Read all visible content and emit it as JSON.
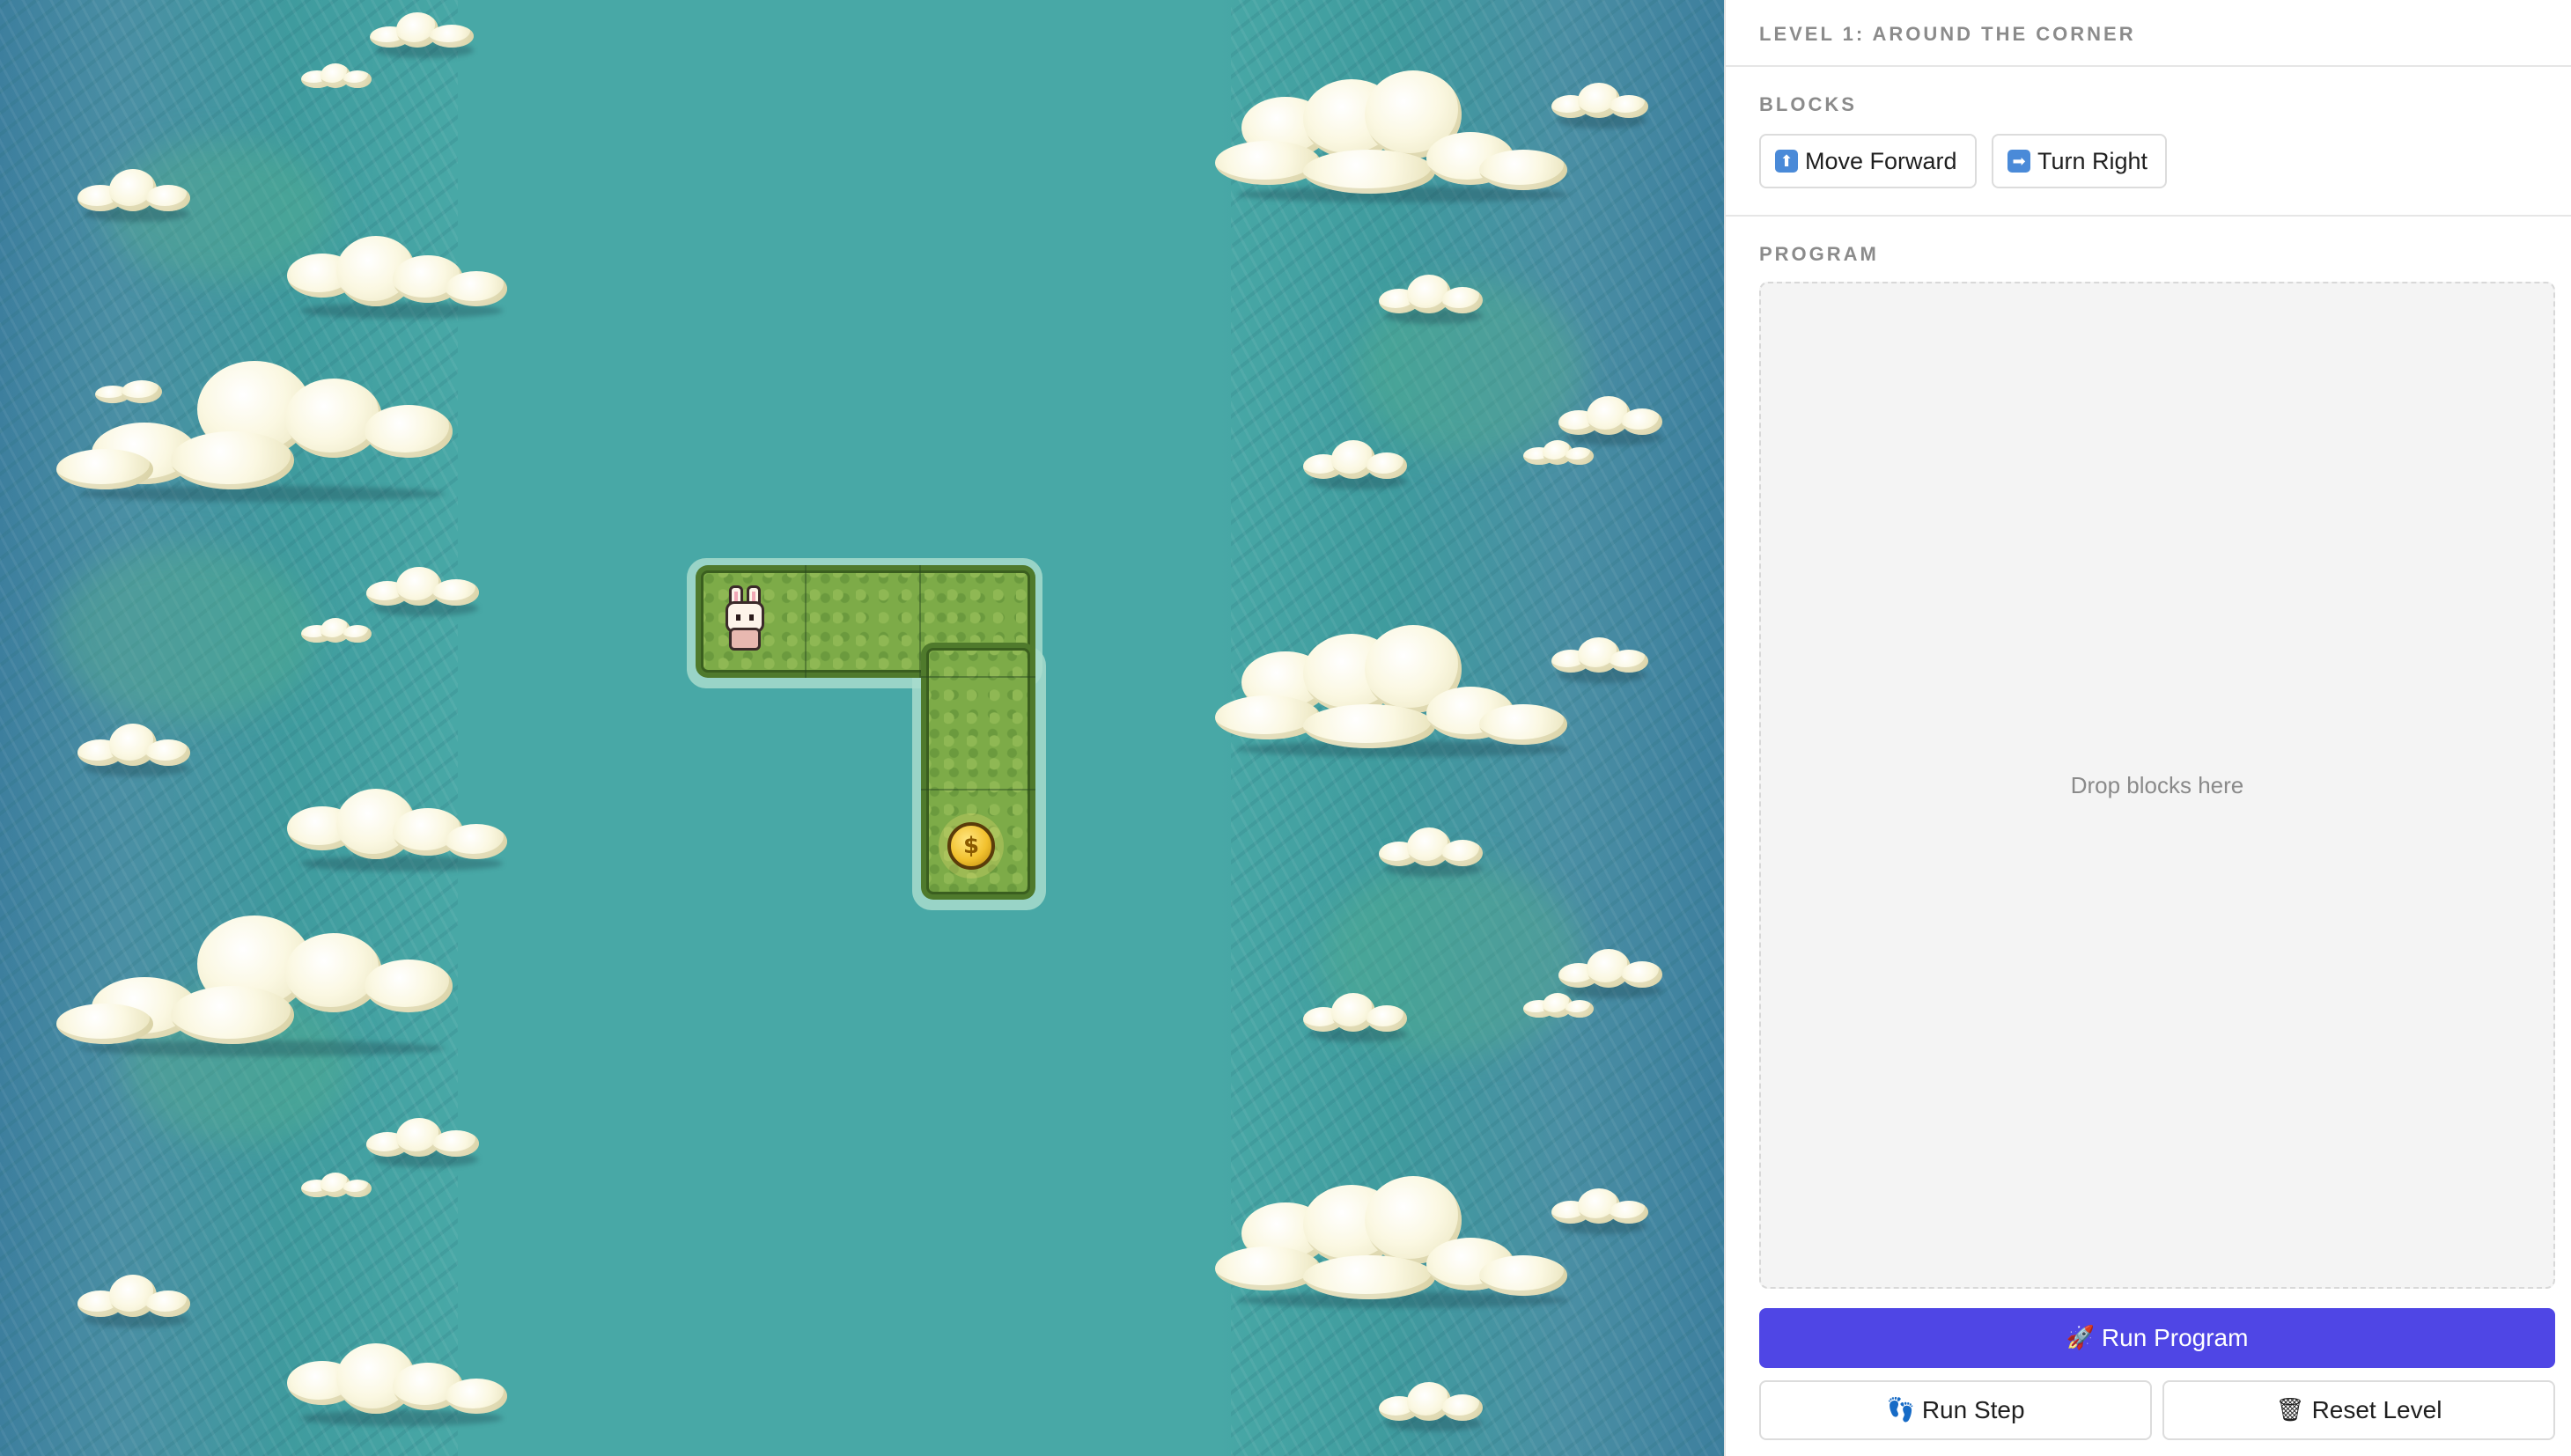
{
  "level": {
    "title": "LEVEL 1: AROUND THE CORNER"
  },
  "blocks": {
    "section_label": "BLOCKS",
    "items": [
      {
        "label": "Move Forward",
        "icon": "up-arrow-icon",
        "glyph": "⬆"
      },
      {
        "label": "Turn Right",
        "icon": "right-arrow-icon",
        "glyph": "➡"
      }
    ]
  },
  "program": {
    "section_label": "PROGRAM",
    "placeholder": "Drop blocks here"
  },
  "controls": {
    "run_program": {
      "label": "Run Program",
      "icon": "rocket-icon",
      "glyph": "🚀"
    },
    "run_step": {
      "label": "Run Step",
      "icon": "footprints-icon",
      "glyph": "👣"
    },
    "reset_level": {
      "label": "Reset Level",
      "icon": "trash-icon",
      "glyph": "🗑"
    }
  },
  "game": {
    "player": "bunny",
    "goal": "coin",
    "path_tiles": 5,
    "colors": {
      "water": "#48a8a6",
      "grass": "#7dab48",
      "accent": "#4f46e5"
    }
  }
}
